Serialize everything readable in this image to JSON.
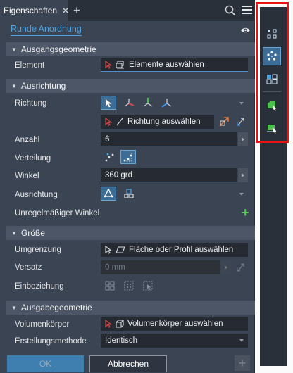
{
  "tabs": {
    "active_label": "Eigenschaften",
    "close_glyph": "✕",
    "add_glyph": "+"
  },
  "feature": {
    "title": "Runde Anordnung"
  },
  "sections": {
    "input": "Ausgangsgeometrie",
    "orientation": "Ausrichtung",
    "size": "Größe",
    "output": "Ausgabegeometrie"
  },
  "input": {
    "element_label": "Element",
    "element_value": "Elemente auswählen"
  },
  "orientation": {
    "direction_label": "Richtung",
    "direction_value": "Richtung auswählen",
    "count_label": "Anzahl",
    "count_value": "6",
    "distribution_label": "Verteilung",
    "angle_label": "Winkel",
    "angle_value": "360 grd",
    "alignment_label": "Ausrichtung",
    "irregular_label": "Unregelmäßiger Winkel"
  },
  "size": {
    "boundary_label": "Umgrenzung",
    "boundary_value": "Fläche oder Profil auswählen",
    "offset_label": "Versatz",
    "offset_placeholder": "0 mm",
    "inclusion_label": "Einbeziehung"
  },
  "output": {
    "solid_label": "Volumenkörper",
    "solid_value": "Volumenkörper auswählen",
    "method_label": "Erstellungsmethode",
    "method_value": "Identisch"
  },
  "footer": {
    "ok_label": "OK",
    "cancel_label": "Abbrechen",
    "plus_label": "+"
  },
  "colors": {
    "accent": "#4fa3e0",
    "panel_bg": "#3b4453",
    "section_bg": "#4c5666",
    "highlight_box": "#ee1111",
    "add_green": "#5ac85a"
  }
}
